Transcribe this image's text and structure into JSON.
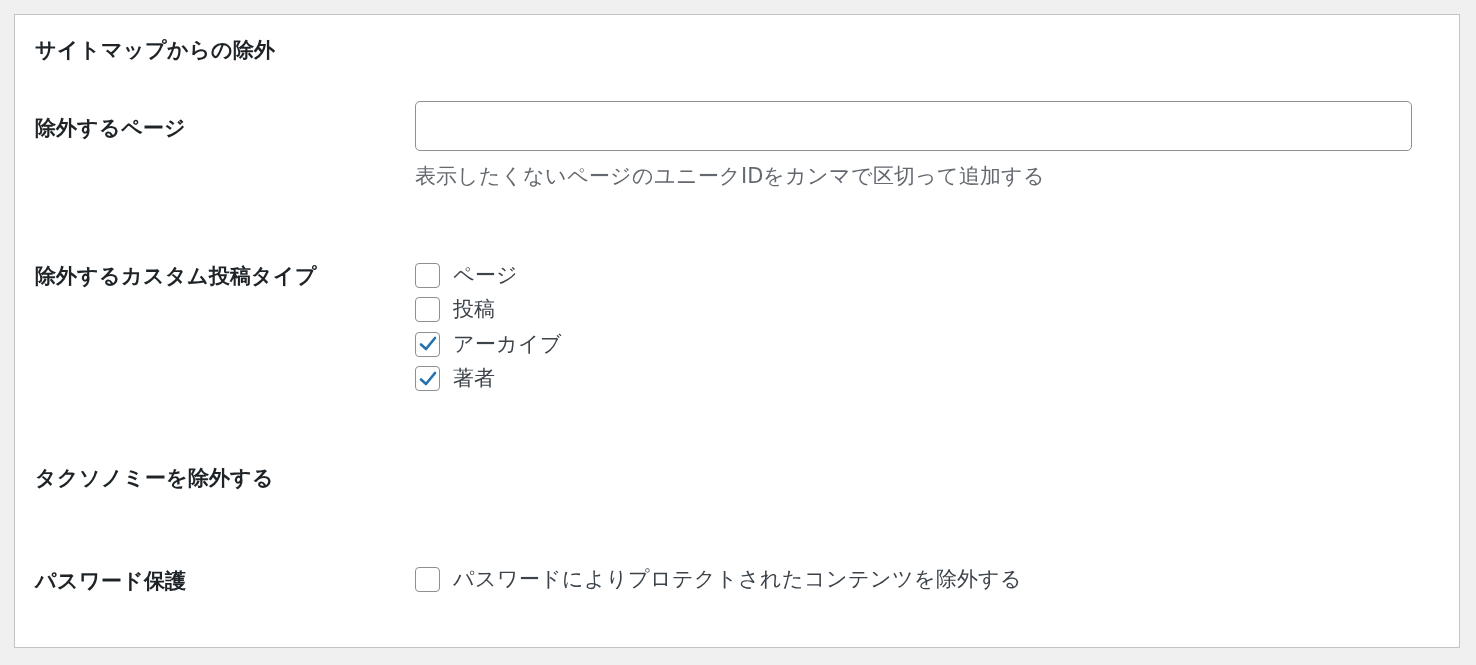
{
  "section_title": "サイトマップからの除外",
  "rows": [
    {
      "kind": "text",
      "label": "除外するページ",
      "field": {},
      "help": "表示したくないページのユニークIDをカンマで区切って追加する"
    },
    {
      "kind": "checkboxes",
      "label": "除外するカスタム投稿タイプ",
      "options": [
        {
          "label": "ページ",
          "checked": false
        },
        {
          "label": "投稿",
          "checked": false
        },
        {
          "label": "アーカイブ",
          "checked": true
        },
        {
          "label": "著者",
          "checked": true
        }
      ]
    },
    {
      "kind": "empty",
      "label": "タクソノミーを除外する"
    },
    {
      "kind": "checkboxes",
      "label": "パスワード保護",
      "options": [
        {
          "label": "パスワードによりプロテクトされたコンテンツを除外する",
          "checked": false
        }
      ]
    }
  ]
}
